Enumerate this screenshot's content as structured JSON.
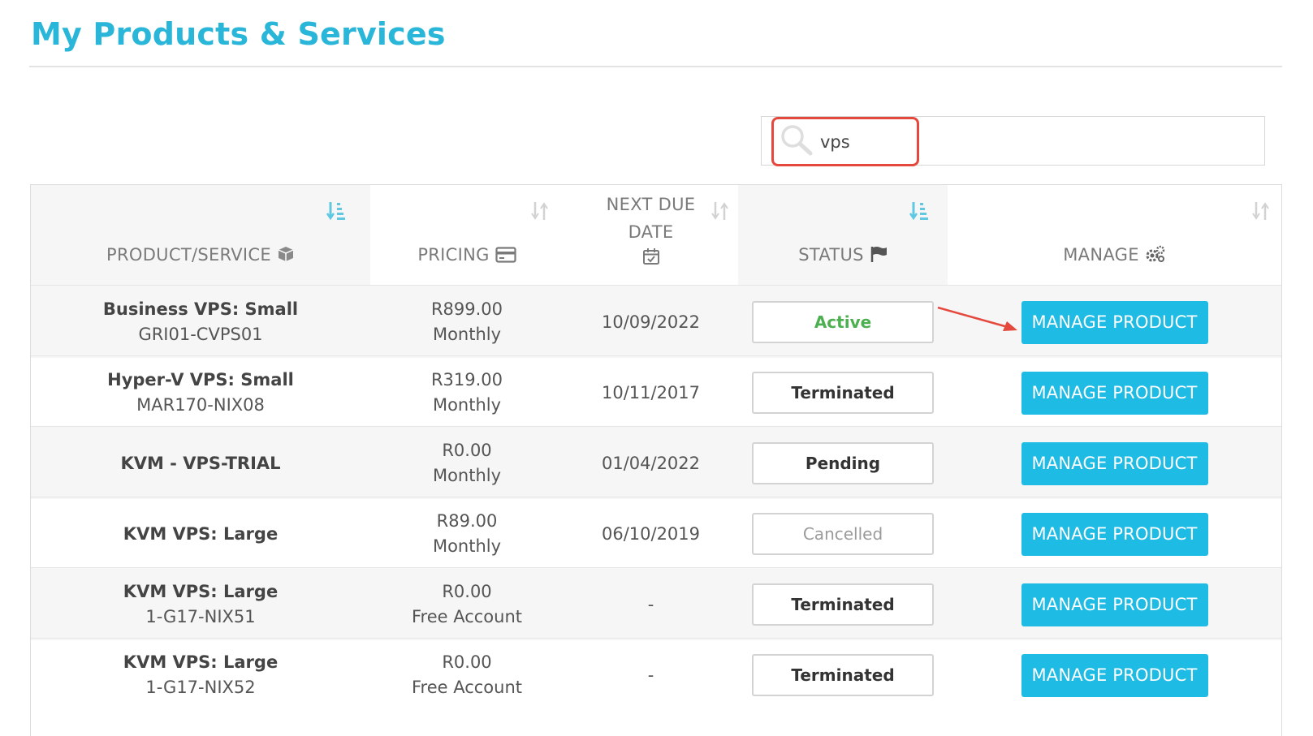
{
  "page": {
    "title": "My Products & Services"
  },
  "search": {
    "value": "vps"
  },
  "table": {
    "headers": {
      "product": "PRODUCT/SERVICE",
      "pricing": "PRICING",
      "next_due_line1": "NEXT DUE",
      "next_due_line2": "DATE",
      "status": "STATUS",
      "manage": "MANAGE"
    },
    "rows": [
      {
        "name": "Business VPS: Small",
        "host": "GRI01-CVPS01",
        "price": "R899.00",
        "cycle": "Monthly",
        "due": "10/09/2022",
        "status": "Active",
        "action": "MANAGE PRODUCT"
      },
      {
        "name": "Hyper-V VPS: Small",
        "host": "MAR170-NIX08",
        "price": "R319.00",
        "cycle": "Monthly",
        "due": "10/11/2017",
        "status": "Terminated",
        "action": "MANAGE PRODUCT"
      },
      {
        "name": "KVM - VPS-TRIAL",
        "host": "",
        "price": "R0.00",
        "cycle": "Monthly",
        "due": "01/04/2022",
        "status": "Pending",
        "action": "MANAGE PRODUCT"
      },
      {
        "name": "KVM VPS: Large",
        "host": "",
        "price": "R89.00",
        "cycle": "Monthly",
        "due": "06/10/2019",
        "status": "Cancelled",
        "action": "MANAGE PRODUCT"
      },
      {
        "name": "KVM VPS: Large",
        "host": "1-G17-NIX51",
        "price": "R0.00",
        "cycle": "Free Account",
        "due": "-",
        "status": "Terminated",
        "action": "MANAGE PRODUCT"
      },
      {
        "name": "KVM VPS: Large",
        "host": "1-G17-NIX52",
        "price": "R0.00",
        "cycle": "Free Account",
        "due": "-",
        "status": "Terminated",
        "action": "MANAGE PRODUCT"
      }
    ]
  },
  "colors": {
    "accent": "#29b6d8",
    "button": "#1ebbe5",
    "active_status": "#4caf50",
    "highlight": "#e5483c"
  },
  "icons": [
    "search-icon",
    "cube-icon",
    "credit-card-icon",
    "calendar-check-icon",
    "flag-icon",
    "gears-icon",
    "sort-icon",
    "sort-active-icon"
  ]
}
